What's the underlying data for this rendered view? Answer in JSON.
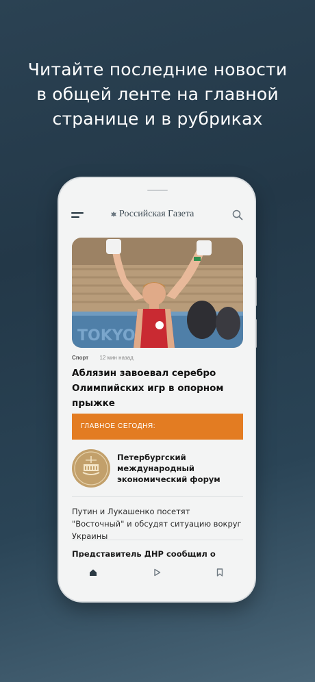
{
  "promo": {
    "line1": "Читайте последние новости",
    "line2": "в общей ленте на главной",
    "line3": "странице и в рубриках"
  },
  "app": {
    "logo_text": "Российская Газета",
    "icons": {
      "menu": "menu-icon",
      "search": "search-icon",
      "emblem": "eagle-emblem-icon"
    }
  },
  "article": {
    "rubric": "Спорт",
    "time": "12 мин назад",
    "headline": "Аблязин завоевал серебро Олимпийских игр в опорном прыжке"
  },
  "banner": {
    "label": "ГЛАВНОЕ СЕГОДНЯ:",
    "color": "#e37c22"
  },
  "feed": {
    "forum_title": "Петербургский международный экономический форум",
    "item2": "Путин и Лукашенко посетят \"Восточный\" и обсудят ситуацию вокруг Украины",
    "item3": "Представитель ДНР сообщил о попытке"
  },
  "tabs": [
    {
      "icon": "home-icon",
      "active": true
    },
    {
      "icon": "play-icon",
      "active": false
    },
    {
      "icon": "bookmark-icon",
      "active": false
    }
  ]
}
